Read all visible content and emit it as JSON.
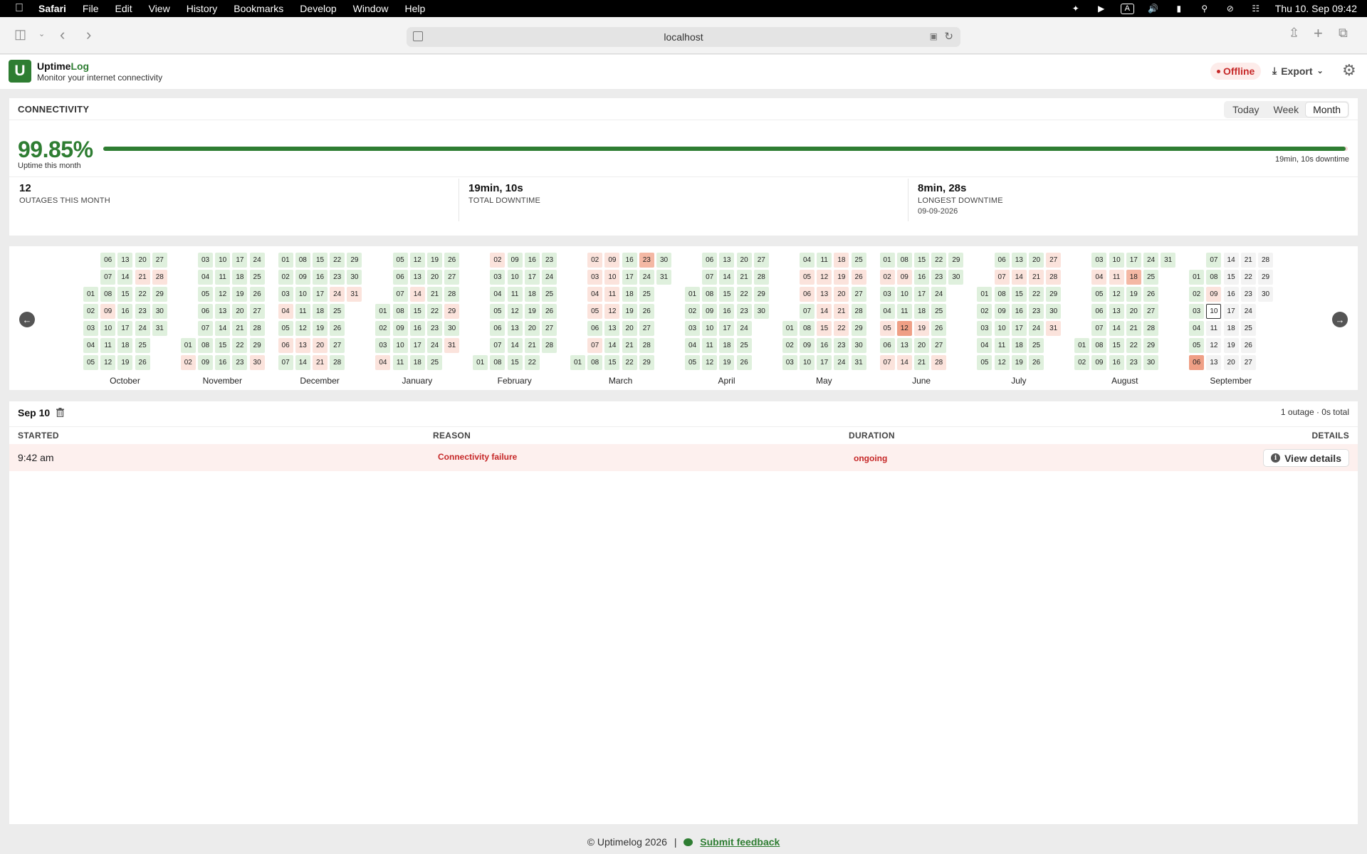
{
  "menubar": {
    "apple": "",
    "items": [
      "Safari",
      "File",
      "Edit",
      "View",
      "History",
      "Bookmarks",
      "Develop",
      "Window",
      "Help"
    ],
    "input_indicator": "A",
    "clock": "Thu 10. Sep  09:42"
  },
  "browser": {
    "url": "localhost"
  },
  "app": {
    "logo_letter": "U",
    "brand_a": "Uptime",
    "brand_b": "Log",
    "tagline": "Monitor your internet connectivity",
    "status": "Offline",
    "export_label": "Export",
    "colors": {
      "accent": "#2e7d32",
      "danger": "#c62828"
    }
  },
  "connectivity": {
    "title": "CONNECTIVITY",
    "ranges": [
      "Today",
      "Week",
      "Month"
    ],
    "active_range": "Month",
    "uptime_percent": "99.85%",
    "uptime_fraction": 0.9985,
    "uptime_label": "Uptime this month",
    "downtime_note": "19min, 10s downtime",
    "stats": [
      {
        "value": "12",
        "label": "OUTAGES THIS MONTH",
        "detail": ""
      },
      {
        "value": "19min, 10s",
        "label": "TOTAL DOWNTIME",
        "detail": ""
      },
      {
        "value": "8min, 28s",
        "label": "LONGEST DOWNTIME",
        "detail": "09-09-2026"
      }
    ]
  },
  "calendar": {
    "months": [
      {
        "name": "October",
        "lead": 2,
        "days": 31,
        "low": [
          9,
          21,
          28
        ],
        "mid": [],
        "high": []
      },
      {
        "name": "November",
        "lead": 5,
        "days": 30,
        "low": [
          2,
          30
        ],
        "mid": [],
        "high": []
      },
      {
        "name": "December",
        "lead": 0,
        "days": 31,
        "low": [
          4,
          6,
          13,
          20,
          21,
          24,
          31
        ],
        "mid": [],
        "high": []
      },
      {
        "name": "January",
        "lead": 3,
        "days": 31,
        "low": [
          4,
          14,
          29,
          31
        ],
        "mid": [],
        "high": []
      },
      {
        "name": "February",
        "lead": 6,
        "days": 28,
        "low": [
          2
        ],
        "mid": [],
        "high": []
      },
      {
        "name": "March",
        "lead": 6,
        "days": 31,
        "low": [
          2,
          3,
          4,
          5,
          7,
          9,
          10,
          11,
          12
        ],
        "mid": [
          23
        ],
        "high": []
      },
      {
        "name": "April",
        "lead": 2,
        "days": 30,
        "low": [],
        "mid": [],
        "high": []
      },
      {
        "name": "May",
        "lead": 4,
        "days": 31,
        "low": [
          5,
          6,
          12,
          13,
          14,
          15,
          18,
          19,
          20,
          21,
          22,
          26
        ],
        "mid": [],
        "high": []
      },
      {
        "name": "June",
        "lead": 0,
        "days": 30,
        "low": [
          2,
          5,
          7,
          9,
          14,
          19,
          28
        ],
        "mid": [],
        "high": [
          12
        ]
      },
      {
        "name": "July",
        "lead": 2,
        "days": 31,
        "low": [
          7,
          14,
          21,
          27,
          28,
          31
        ],
        "mid": [],
        "high": []
      },
      {
        "name": "August",
        "lead": 5,
        "days": 31,
        "low": [
          4,
          11
        ],
        "mid": [
          18
        ],
        "high": []
      },
      {
        "name": "September",
        "lead": 1,
        "days": 30,
        "low": [
          9
        ],
        "mid": [],
        "high": [
          6
        ],
        "today": 10,
        "future_from": 11
      }
    ],
    "prev_icon": "arrow-left-icon",
    "next_icon": "arrow-right-icon"
  },
  "day_detail": {
    "title": "Sep 10",
    "summary": "1 outage · 0s total",
    "headers": {
      "started": "STARTED",
      "reason": "REASON",
      "duration": "DURATION",
      "details": "DETAILS"
    },
    "rows": [
      {
        "started": "9:42 am",
        "reason": "Connectivity failure",
        "duration": "ongoing",
        "action": "View details"
      }
    ]
  },
  "footer": {
    "copyright": "© Uptimelog 2026",
    "separator": "|",
    "feedback": "Submit feedback"
  }
}
